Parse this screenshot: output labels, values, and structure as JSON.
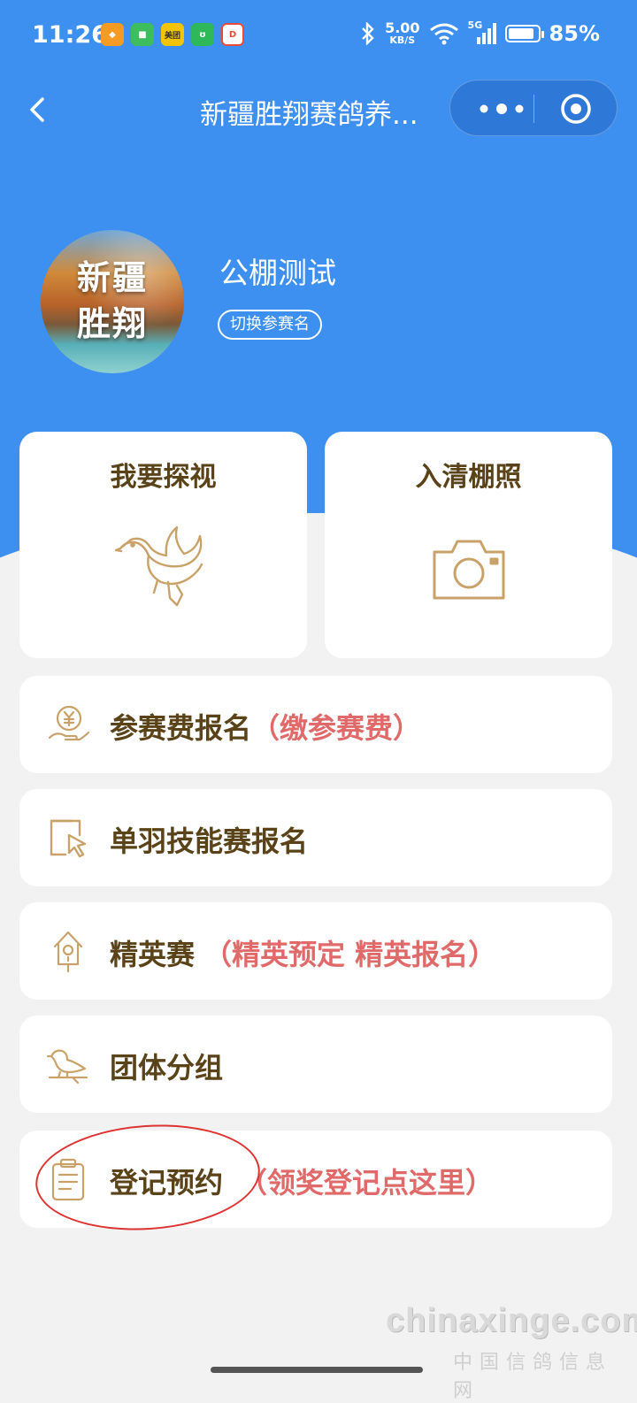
{
  "status_bar": {
    "time": "11:26",
    "net_speed_value": "5.00",
    "net_speed_unit": "KB/S",
    "network": "5G",
    "battery": "85%",
    "app_icons": [
      {
        "name": "orange-app-icon",
        "color": "#f59a23",
        "text": "◆"
      },
      {
        "name": "message-app-icon",
        "color": "#3dbd5d",
        "text": "■"
      },
      {
        "name": "meituan-app-icon",
        "color": "#f5c400",
        "text": "美团"
      },
      {
        "name": "green-app-icon",
        "color": "#2fb859",
        "text": "ʊ"
      },
      {
        "name": "red-app-icon",
        "color": "#e84a3a",
        "text": "D"
      }
    ]
  },
  "nav": {
    "title": "新疆胜翔赛鸽养..."
  },
  "profile": {
    "avatar_text_line1": "新疆",
    "avatar_text_line2": "胜翔",
    "name": "公棚测试",
    "switch_label": "切换参赛名"
  },
  "tiles": [
    {
      "title": "我要探视",
      "icon": "dove-icon"
    },
    {
      "title": "入清棚照",
      "icon": "camera-icon"
    }
  ],
  "menu": [
    {
      "label": "参赛费报名",
      "note": "（缴参赛费）",
      "icon": "money-hand-icon"
    },
    {
      "label": "单羽技能赛报名",
      "note": "",
      "icon": "cursor-select-icon"
    },
    {
      "label": "精英赛",
      "note": "（精英预定 精英报名）",
      "icon": "birdhouse-icon"
    },
    {
      "label": "团体分组",
      "note": "",
      "icon": "bird-perch-icon"
    },
    {
      "label": "登记预约",
      "note": "（领奖登记点这里）",
      "icon": "clipboard-icon"
    }
  ],
  "colors": {
    "header_blue": "#3d8ff0",
    "label_brown": "#5a4318",
    "note_red": "#e06a6a",
    "icon_gold": "#c9a26a"
  },
  "watermark": {
    "domain": "chinaxinge.com",
    "cn": "中国信鸽信息网"
  }
}
